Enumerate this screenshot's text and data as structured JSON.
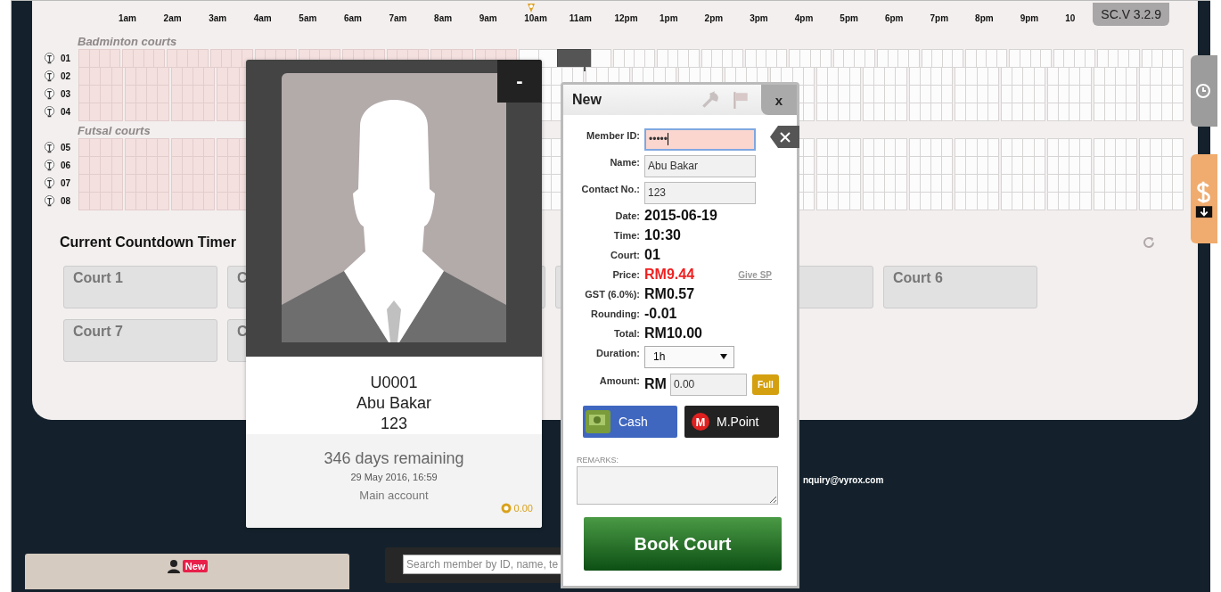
{
  "version": "SC.V 3.2.9",
  "hour_labels": [
    {
      "label": "1am",
      "current": false
    },
    {
      "label": "2am",
      "current": false
    },
    {
      "label": "3am",
      "current": false
    },
    {
      "label": "4am",
      "current": false
    },
    {
      "label": "5am",
      "current": false
    },
    {
      "label": "6am",
      "current": false
    },
    {
      "label": "7am",
      "current": false
    },
    {
      "label": "8am",
      "current": false
    },
    {
      "label": "9am",
      "current": false
    },
    {
      "label": "10am",
      "current": true
    },
    {
      "label": "11am",
      "current": false
    },
    {
      "label": "12pm",
      "current": false
    },
    {
      "label": "1pm",
      "current": false
    },
    {
      "label": "2pm",
      "current": false
    },
    {
      "label": "3pm",
      "current": false
    },
    {
      "label": "4pm",
      "current": false
    },
    {
      "label": "5pm",
      "current": false
    },
    {
      "label": "6pm",
      "current": false
    },
    {
      "label": "7pm",
      "current": false
    },
    {
      "label": "8pm",
      "current": false
    },
    {
      "label": "9pm",
      "current": false
    },
    {
      "label": "10",
      "current": false
    }
  ],
  "hour_blocks": [
    {
      "past": true
    },
    {
      "past": true
    },
    {
      "past": true
    },
    {
      "past": true
    },
    {
      "past": true
    },
    {
      "past": true
    },
    {
      "past": true
    },
    {
      "past": true
    },
    {
      "past": true
    },
    {
      "past": true
    },
    {
      "past": false
    },
    {
      "past": false
    },
    {
      "past": false
    },
    {
      "past": false
    },
    {
      "past": false
    },
    {
      "past": false
    },
    {
      "past": false
    },
    {
      "past": false
    },
    {
      "past": false
    },
    {
      "past": false
    },
    {
      "past": false
    },
    {
      "past": false
    },
    {
      "past": false
    },
    {
      "past": false
    }
  ],
  "court_groups": [
    {
      "title": "Badminton courts",
      "courts": [
        {
          "number": "01",
          "selected": true
        },
        {
          "number": "02",
          "selected": false
        },
        {
          "number": "03",
          "selected": false
        },
        {
          "number": "04",
          "selected": false
        }
      ]
    },
    {
      "title": "Futsal courts",
      "courts": [
        {
          "number": "05",
          "selected": false
        },
        {
          "number": "06",
          "selected": false
        },
        {
          "number": "07",
          "selected": false
        },
        {
          "number": "08",
          "selected": false
        }
      ]
    }
  ],
  "countdown": {
    "title": "Current Countdown Timer",
    "courts": [
      {
        "kind": "labeled",
        "label": "Court 1"
      },
      {
        "kind": "labeled",
        "label": "C"
      },
      {
        "kind": "covered"
      },
      {
        "kind": "covered"
      },
      {
        "kind": "covered"
      },
      {
        "kind": "labeled",
        "label": "Court 6"
      },
      {
        "kind": "labeled",
        "label": "Court 7"
      },
      {
        "kind": "labeled",
        "label": "C"
      }
    ]
  },
  "footer": {
    "email": "nquiry@vyrox.com"
  },
  "new_member": {
    "badge": "New"
  },
  "search": {
    "placeholder": "Search member by ID, name, te"
  },
  "profile": {
    "member_id": "U0001",
    "name": "Abu Bakar",
    "contact": "123",
    "remaining": "346 days remaining",
    "expiry": "29 May 2016, 16:59",
    "account": "Main account",
    "balance": "0.00",
    "minimize": "-"
  },
  "dialog": {
    "title": "New",
    "close": "x",
    "fields": [
      {
        "kind": "input",
        "label": "Member ID:",
        "value": "•••••",
        "invalid": true
      },
      {
        "kind": "input",
        "label": "Name:",
        "value": "Abu Bakar",
        "invalid": false
      },
      {
        "kind": "input",
        "label": "Contact No.:",
        "value": "123",
        "invalid": false
      },
      {
        "kind": "text",
        "label": "Date:",
        "value": "2015-06-19"
      },
      {
        "kind": "text",
        "label": "Time:",
        "value": "10:30"
      },
      {
        "kind": "text",
        "label": "Court:",
        "value": "01"
      },
      {
        "kind": "price",
        "label": "Price:",
        "value": "RM9.44",
        "link": "Give SP"
      },
      {
        "kind": "text",
        "label": "GST (6.0%):",
        "value": "RM0.57"
      },
      {
        "kind": "text",
        "label": "Rounding:",
        "value": "-0.01"
      },
      {
        "kind": "text",
        "label": "Total:",
        "value": "RM10.00"
      },
      {
        "kind": "select",
        "label": "Duration:",
        "value": "1h"
      },
      {
        "kind": "amount",
        "label": "Amount:",
        "prefix": "RM",
        "value": "0.00",
        "button": "Full"
      }
    ],
    "payments": [
      {
        "kind": "cash",
        "label": "Cash"
      },
      {
        "kind": "mpoint",
        "label": "M.Point",
        "badge": "M"
      }
    ],
    "remarks_label": "REMARKS:",
    "submit": "Book Court"
  }
}
